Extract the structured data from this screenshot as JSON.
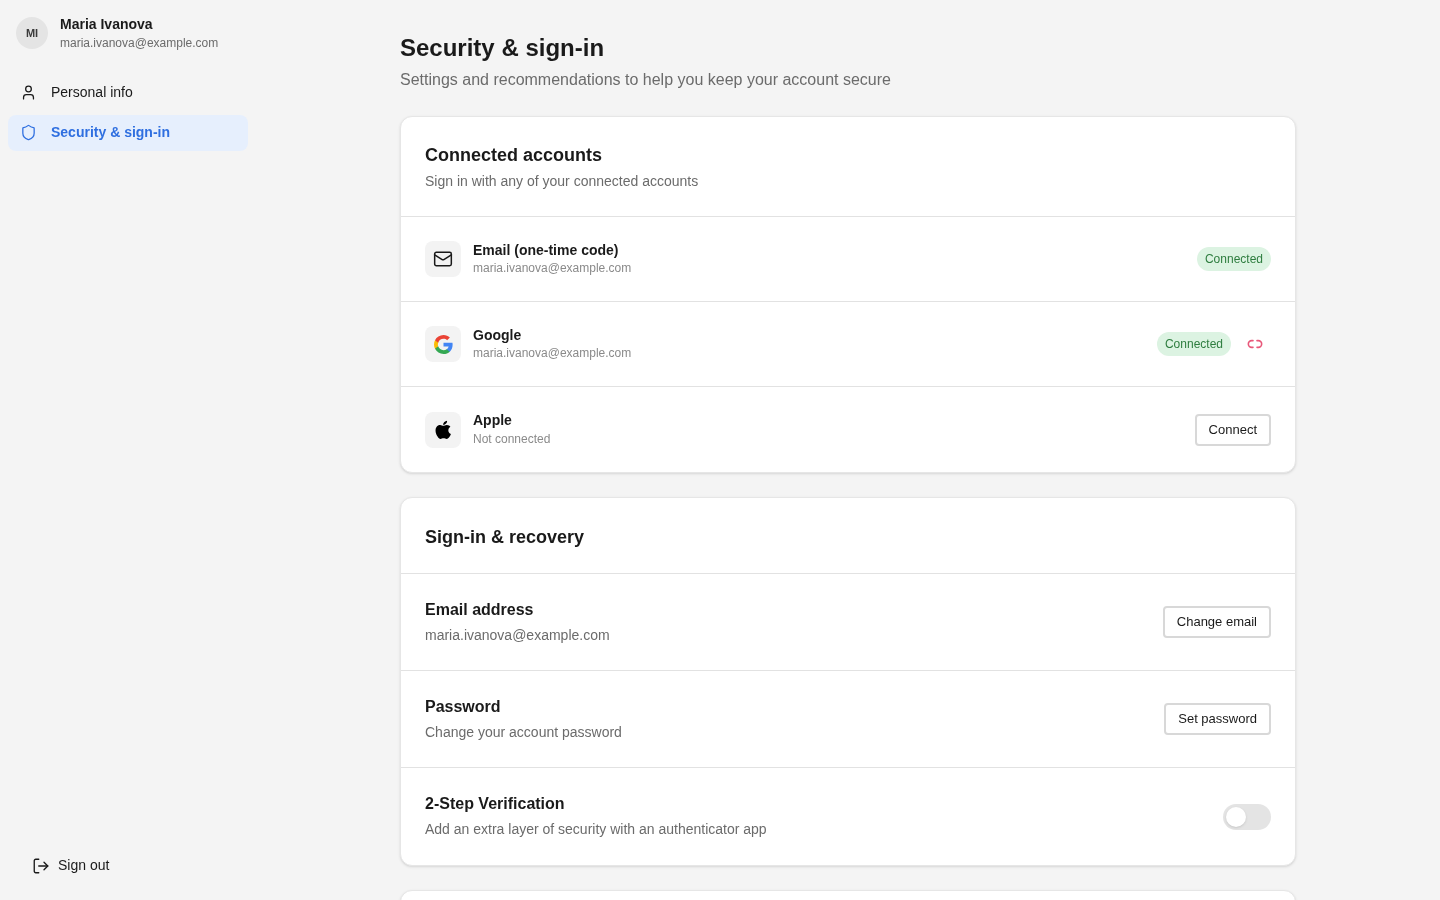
{
  "sidebar": {
    "user": {
      "initials": "MI",
      "name": "Maria Ivanova",
      "email": "maria.ivanova@example.com"
    },
    "items": [
      {
        "label": "Personal info",
        "selected": false
      },
      {
        "label": "Security & sign-in",
        "selected": true
      }
    ],
    "sign_out": "Sign out"
  },
  "header": {
    "title": "Security & sign-in",
    "subtitle": "Settings and recommendations to help you keep your account secure"
  },
  "connected_accounts": {
    "title": "Connected accounts",
    "subtitle": "Sign in with any of your connected accounts",
    "accounts": [
      {
        "kind": "email",
        "name": "Email (one-time code)",
        "detail": "maria.ivanova@example.com",
        "badge": "Connected",
        "unlink": false
      },
      {
        "kind": "google",
        "name": "Google",
        "detail": "maria.ivanova@example.com",
        "badge": "Connected",
        "unlink": true
      },
      {
        "kind": "apple",
        "name": "Apple",
        "detail": "Not connected",
        "button": "Connect",
        "unlink": false
      }
    ]
  },
  "sign_in_recovery": {
    "title": "Sign-in & recovery",
    "rows": [
      {
        "kind": "button",
        "label": "Email address",
        "detail": "maria.ivanova@example.com",
        "button": "Change email"
      },
      {
        "kind": "button",
        "label": "Password",
        "detail": "Change your account password",
        "button": "Set password"
      },
      {
        "kind": "toggle",
        "label": "2-Step Verification",
        "detail": "Add an extra layer of security with an authenticator app",
        "on": false
      }
    ]
  }
}
